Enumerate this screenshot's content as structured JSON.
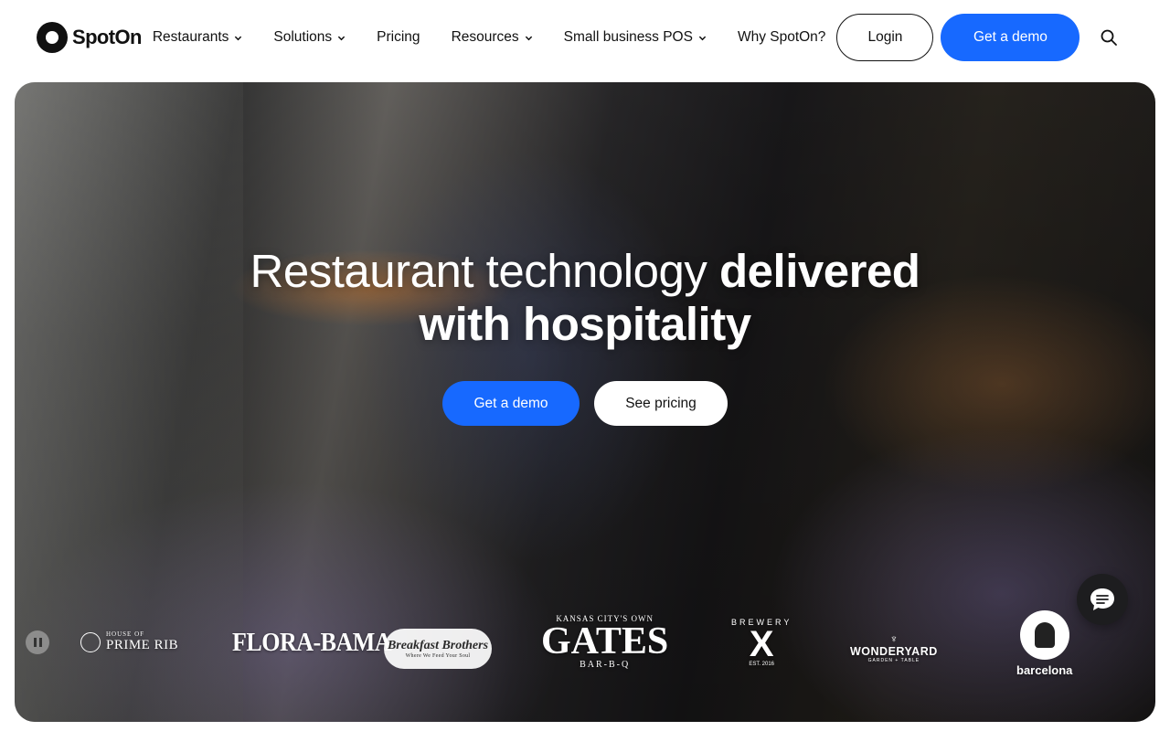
{
  "brand": {
    "name": "SpotOn"
  },
  "nav": {
    "items": [
      {
        "label": "Restaurants",
        "has_dropdown": true
      },
      {
        "label": "Solutions",
        "has_dropdown": true
      },
      {
        "label": "Pricing",
        "has_dropdown": false
      },
      {
        "label": "Resources",
        "has_dropdown": true
      },
      {
        "label": "Small business POS",
        "has_dropdown": true
      },
      {
        "label": "Why SpotOn?",
        "has_dropdown": false
      }
    ],
    "login_label": "Login",
    "demo_label": "Get a demo",
    "search_icon": "search-icon"
  },
  "hero": {
    "title_light_1": "Restaurant technology",
    "title_bold_1": "delivered",
    "title_bold_2": "with hospitality",
    "primary_cta": "Get a demo",
    "secondary_cta": "See pricing",
    "pause_icon": "pause-icon"
  },
  "logos": {
    "house": {
      "small": "HOUSE OF",
      "big": "PRIME RIB"
    },
    "flora": "FLORA-BAMA",
    "breakfast": {
      "title": "Breakfast Brothers",
      "tagline": "Where We Feed Your Soul"
    },
    "gates": {
      "top": "KANSAS CITY'S OWN",
      "main": "GATES",
      "bottom": "BAR-B-Q"
    },
    "brewery": {
      "top": "BREWERY",
      "main": "X",
      "bottom": "EST. 2016"
    },
    "wonderyard": {
      "main": "WONDERYARD",
      "sub": "GARDEN + TABLE"
    },
    "barcelona": "barcelona"
  },
  "chat": {
    "icon": "chat-icon"
  },
  "colors": {
    "accent": "#1769ff",
    "text": "#111111",
    "chat_bg": "#1d1d1f"
  }
}
